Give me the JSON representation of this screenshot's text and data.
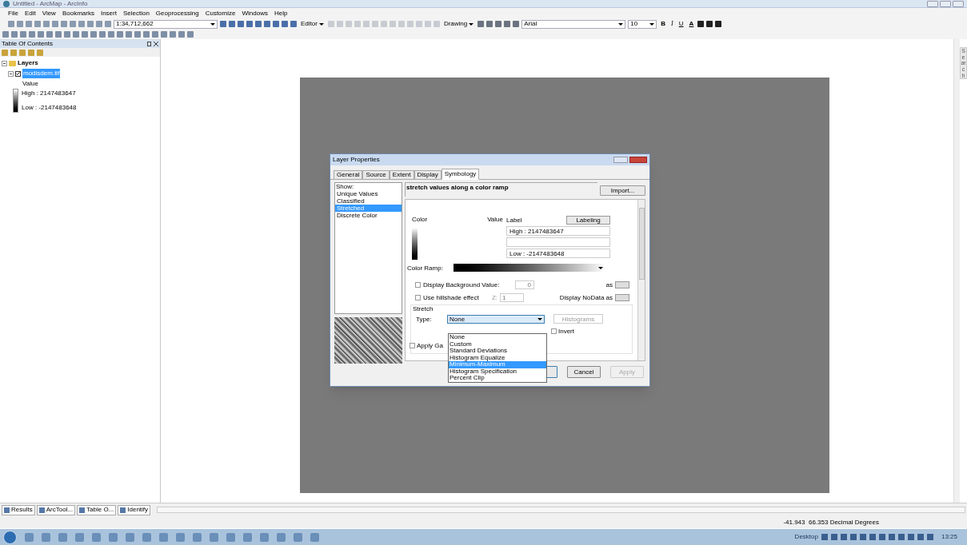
{
  "window": {
    "title": "Untitled - ArcMap - ArcInfo"
  },
  "menu": [
    "File",
    "Edit",
    "View",
    "Bookmarks",
    "Insert",
    "Selection",
    "Geoprocessing",
    "Customize",
    "Windows",
    "Help"
  ],
  "toolbar": {
    "scale": "1:34,712,662",
    "editor": "Editor",
    "drawing": "Drawing",
    "font": "Arial",
    "font_size": "10",
    "bold": "B",
    "italic": "I",
    "underline": "U",
    "text_color": "A"
  },
  "toc": {
    "title": "Table Of Contents",
    "root": {
      "label": "Layers",
      "expanded": true,
      "children": [
        {
          "label": "modisdem.tif",
          "checked": true,
          "selected": true,
          "expanded": true,
          "legend": {
            "heading": "Value",
            "high": "High : 2147483647",
            "low": "Low : -2147483648"
          }
        }
      ]
    }
  },
  "dialog": {
    "title": "Layer Properties",
    "tabs": [
      {
        "label": "General",
        "selected": false
      },
      {
        "label": "Source",
        "selected": false
      },
      {
        "label": "Extent",
        "selected": false
      },
      {
        "label": "Display",
        "selected": false
      },
      {
        "label": "Symbology",
        "selected": true
      }
    ],
    "show_label": "Show:",
    "show_items": [
      {
        "label": "Unique Values",
        "selected": false
      },
      {
        "label": "Classified",
        "selected": false
      },
      {
        "label": "Stretched",
        "selected": true
      },
      {
        "label": "Discrete Color",
        "selected": false
      }
    ],
    "description": "stretch values along a color ramp",
    "import_button": "Import...",
    "color_header": "Color",
    "value_header": "Value",
    "label_header": "Label",
    "labeling_button": "Labeling",
    "label_high": "High : 2147483647",
    "label_low": "Low : -2147483648",
    "color_ramp_label": "Color Ramp:",
    "background": {
      "label": "Display Background Value:",
      "checked": false,
      "value": "0",
      "as": "as"
    },
    "hillshade": {
      "label": "Use hillshade effect",
      "checked": false,
      "z_label": "Z:",
      "z_value": "1",
      "nodata": "Display NoData as"
    },
    "stretch": {
      "title": "Stretch",
      "type_label": "Type:",
      "type_value": "None",
      "histograms": "Histograms",
      "invert": {
        "label": "Invert",
        "checked": false
      },
      "apply_gamma": {
        "label": "Apply Ga",
        "checked": false
      }
    },
    "dropdown": [
      {
        "label": "None",
        "selected": false
      },
      {
        "label": "Custom",
        "selected": false
      },
      {
        "label": "Standard Deviations",
        "selected": false
      },
      {
        "label": "Histogram Equalize",
        "selected": false
      },
      {
        "label": "Minimum-Maximum",
        "selected": true
      },
      {
        "label": "Histogram Specification",
        "selected": false
      },
      {
        "label": "Percent Clip",
        "selected": false
      }
    ],
    "buttons": [
      {
        "label": "Cancel",
        "disabled": false
      },
      {
        "label": "Apply",
        "disabled": true
      }
    ]
  },
  "bottom_tabs": [
    "Results",
    "ArcTool...",
    "Table O...",
    "Identify"
  ],
  "status": {
    "coordinates": "-41.943  66.353 Decimal Degrees"
  },
  "taskbar": {
    "desktop": "Desktop",
    "clock": "13:25"
  },
  "side_tab": "Search"
}
